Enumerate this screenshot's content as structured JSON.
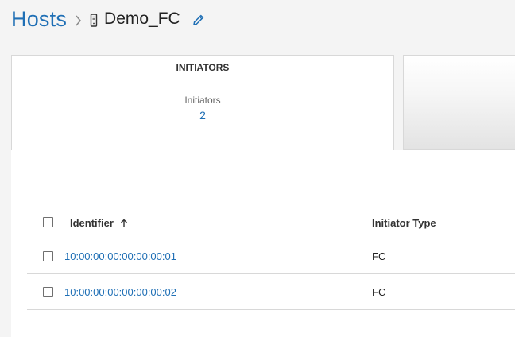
{
  "breadcrumb": {
    "root": "Hosts",
    "separator_icon": "chevron-right-icon",
    "host_icon": "server-icon",
    "current": "Demo_FC",
    "edit_icon": "pencil-icon"
  },
  "summary_card": {
    "title": "INITIATORS",
    "metric_label": "Initiators",
    "metric_value": "2"
  },
  "table": {
    "columns": {
      "identifier": "Identifier",
      "initiator_type": "Initiator Type"
    },
    "sort": {
      "column": "identifier",
      "direction": "ascending",
      "icon": "arrow-up-icon"
    },
    "rows": [
      {
        "identifier": "10:00:00:00:00:00:00:01",
        "initiator_type": "FC"
      },
      {
        "identifier": "10:00:00:00:00:00:00:02",
        "initiator_type": "FC"
      }
    ]
  },
  "colors": {
    "link": "#1f6fb5",
    "text": "#222222",
    "background": "#f4f4f4"
  }
}
